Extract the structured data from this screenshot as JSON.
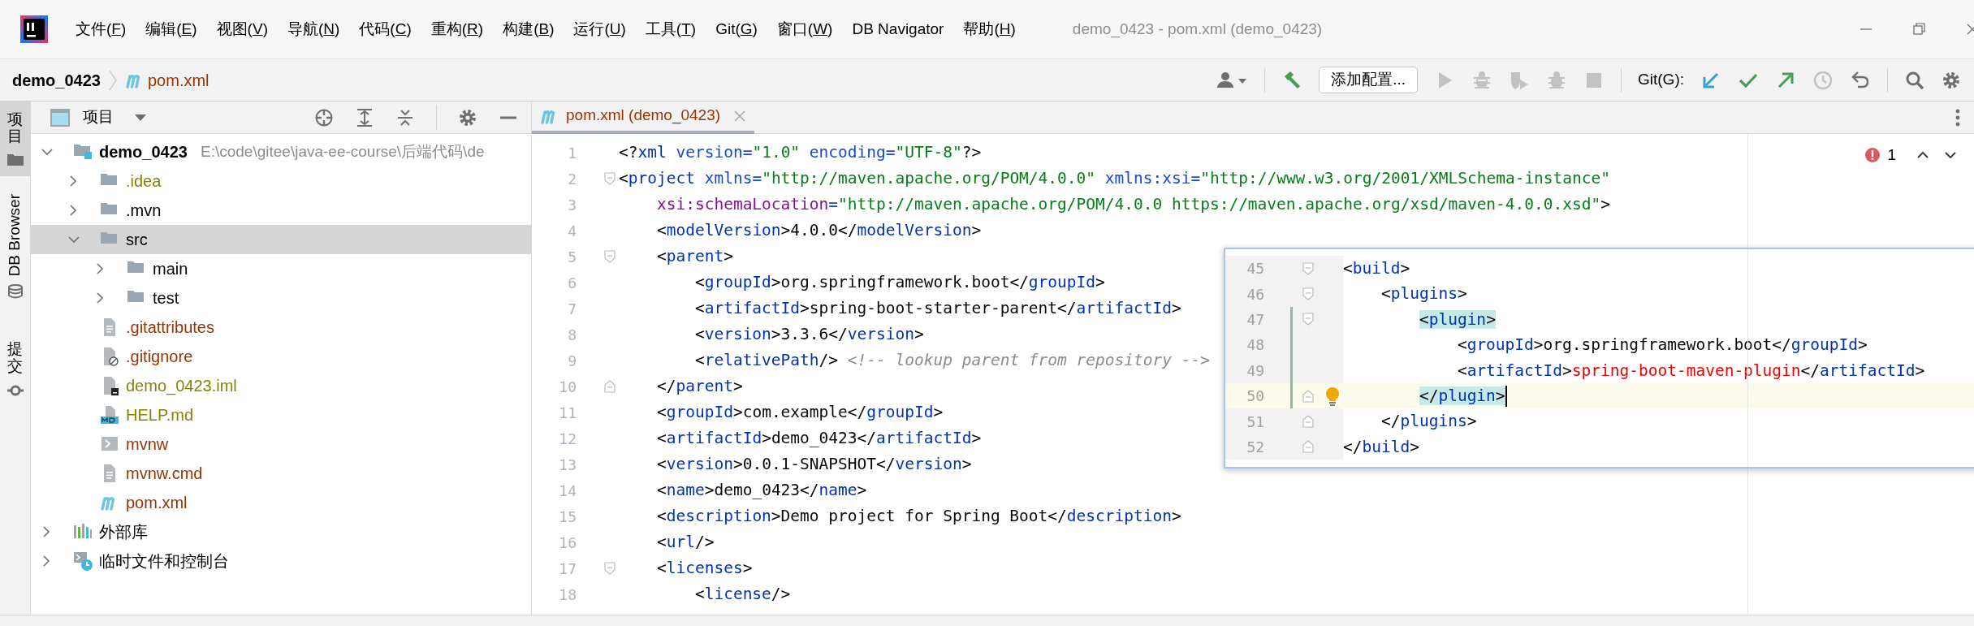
{
  "window": {
    "title": "demo_0423 - pom.xml (demo_0423)"
  },
  "menu": [
    "文件(F)",
    "编辑(E)",
    "视图(V)",
    "导航(N)",
    "代码(C)",
    "重构(R)",
    "构建(B)",
    "运行(U)",
    "工具(T)",
    "Git(G)",
    "窗口(W)",
    "DB Navigator",
    "帮助(H)"
  ],
  "breadcrumb": [
    {
      "label": "demo_0423",
      "kind": "project",
      "color": "#000000"
    },
    {
      "label": "pom.xml",
      "kind": "maven-file",
      "color": "#993300"
    }
  ],
  "toolbar": {
    "run_config": "添加配置...",
    "git_label": "Git(G):",
    "run_actions": [
      {
        "kind": "run",
        "disabled": true
      },
      {
        "kind": "debug",
        "disabled": true
      },
      {
        "kind": "coverage",
        "disabled": true
      },
      {
        "kind": "profile",
        "disabled": true
      },
      {
        "kind": "stop",
        "disabled": true
      }
    ]
  },
  "tool_stripe": [
    {
      "label": "项目",
      "kind": "project",
      "selected": true
    },
    {
      "label": "DB Browser",
      "kind": "db",
      "selected": false
    },
    {
      "label": "提交",
      "kind": "commit",
      "selected": false
    }
  ],
  "project_panel": {
    "title": "项目",
    "tree": [
      {
        "name": "demo_0423",
        "path": "E:\\code\\gitee\\java-ee-course\\后端代码\\de",
        "kind": "module",
        "expanded": true,
        "selected": false,
        "color": "#000000",
        "children": [
          {
            "name": ".idea",
            "kind": "folder",
            "expanded": false,
            "selected": false,
            "color": "#848504"
          },
          {
            "name": ".mvn",
            "kind": "folder",
            "expanded": false,
            "selected": false,
            "color": "#000000"
          },
          {
            "name": "src",
            "kind": "folder",
            "expanded": true,
            "selected": true,
            "color": "#000000",
            "children": [
              {
                "name": "main",
                "kind": "folder",
                "expanded": false,
                "selected": false,
                "color": "#000000"
              },
              {
                "name": "test",
                "kind": "folder",
                "expanded": false,
                "selected": false,
                "color": "#000000"
              }
            ]
          },
          {
            "name": ".gitattributes",
            "kind": "text-file",
            "selected": false,
            "color": "#993300"
          },
          {
            "name": ".gitignore",
            "kind": "ignore-file",
            "selected": false,
            "color": "#993300"
          },
          {
            "name": "demo_0423.iml",
            "kind": "iml-file",
            "selected": false,
            "color": "#848504"
          },
          {
            "name": "HELP.md",
            "kind": "markdown-file",
            "selected": false,
            "color": "#848504"
          },
          {
            "name": "mvnw",
            "kind": "script-file",
            "selected": false,
            "color": "#993300"
          },
          {
            "name": "mvnw.cmd",
            "kind": "text-file",
            "selected": false,
            "color": "#993300"
          },
          {
            "name": "pom.xml",
            "kind": "maven-file",
            "selected": false,
            "color": "#993300"
          }
        ]
      },
      {
        "name": "外部库",
        "kind": "library",
        "expanded": false,
        "selected": false,
        "color": "#000000"
      },
      {
        "name": "临时文件和控制台",
        "kind": "scratch",
        "expanded": false,
        "selected": false,
        "color": "#000000"
      }
    ]
  },
  "editor": {
    "tabs": [
      {
        "label": "pom.xml (demo_0423)",
        "selected": true,
        "color": "#993300"
      }
    ],
    "problems": "1",
    "lines": [
      {
        "number": "1",
        "text": "<?xml version=\"1.0\" encoding=\"UTF-8\"?>"
      },
      {
        "number": "2",
        "text": "<project xmlns=\"http://maven.apache.org/POM/4.0.0\" xmlns:xsi=\"http://www.w3.org/2001/XMLSchema-instance\"",
        "fold_open": true
      },
      {
        "number": "3",
        "text": "    xsi:schemaLocation=\"http://maven.apache.org/POM/4.0.0 https://maven.apache.org/xsd/maven-4.0.0.xsd\">"
      },
      {
        "number": "4",
        "text": "    <modelVersion>4.0.0</modelVersion>"
      },
      {
        "number": "5",
        "text": "    <parent>",
        "fold_open": true
      },
      {
        "number": "6",
        "text": "        <groupId>org.springframework.boot</groupId>"
      },
      {
        "number": "7",
        "text": "        <artifactId>spring-boot-starter-parent</artifactId>"
      },
      {
        "number": "8",
        "text": "        <version>3.3.6</version>"
      },
      {
        "number": "9",
        "text": "        <relativePath/> <!-- lookup parent from repository -->"
      },
      {
        "number": "10",
        "text": "    </parent>",
        "fold_close": true
      },
      {
        "number": "11",
        "text": "    <groupId>com.example</groupId>"
      },
      {
        "number": "12",
        "text": "    <artifactId>demo_0423</artifactId>"
      },
      {
        "number": "13",
        "text": "    <version>0.0.1-SNAPSHOT</version>"
      },
      {
        "number": "14",
        "text": "    <name>demo_0423</name>"
      },
      {
        "number": "15",
        "text": "    <description>Demo project for Spring Boot</description>"
      },
      {
        "number": "16",
        "text": "    <url/>"
      },
      {
        "number": "17",
        "text": "    <licenses>",
        "fold_open": true
      },
      {
        "number": "18",
        "text": "        <license/>"
      }
    ]
  },
  "popup": {
    "lines": [
      {
        "number": "45",
        "text": "<build>",
        "fold_open": true
      },
      {
        "number": "46",
        "text": "    <plugins>",
        "fold_open": true
      },
      {
        "number": "47",
        "text": "        <plugin>",
        "fold_open": true,
        "changed": true,
        "matched": true
      },
      {
        "number": "48",
        "text": "            <groupId>org.springframework.boot</groupId>",
        "changed": true
      },
      {
        "number": "49",
        "text": "            <artifactId>spring-boot-maven-plugin</artifactId>",
        "changed": true,
        "error": true
      },
      {
        "number": "50",
        "text": "        </plugin>",
        "fold_close": true,
        "changed": true,
        "current": true,
        "matched": true,
        "bulb": true,
        "caret": true
      },
      {
        "number": "51",
        "text": "    </plugins>",
        "fold_close": true
      },
      {
        "number": "52",
        "text": "</build>",
        "fold_close": true
      }
    ]
  }
}
